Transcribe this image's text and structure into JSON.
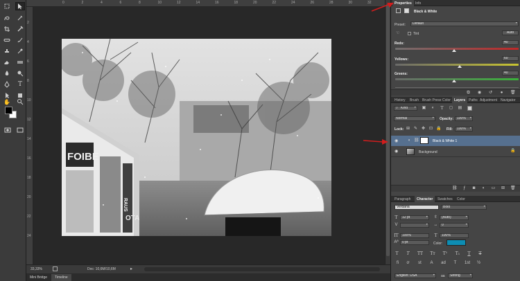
{
  "colors": {
    "accent_red": "#d11d1d",
    "layer_highlight": "#56708f",
    "text_color_chip": "#0d8db3"
  },
  "tools": [
    {
      "name": "move-tool-icon"
    },
    {
      "name": "artboard-tool-icon"
    },
    {
      "name": "marquee-tool-icon"
    },
    {
      "name": "lasso-tool-icon"
    },
    {
      "name": "quick-selection-tool-icon"
    },
    {
      "name": "magic-wand-tool-icon"
    },
    {
      "name": "crop-tool-icon"
    },
    {
      "name": "slice-tool-icon"
    },
    {
      "name": "eyedropper-tool-icon"
    },
    {
      "name": "ruler-tool-icon"
    },
    {
      "name": "healing-brush-tool-icon"
    },
    {
      "name": "patch-tool-icon"
    },
    {
      "name": "brush-tool-icon"
    },
    {
      "name": "pencil-tool-icon"
    },
    {
      "name": "clone-stamp-tool-icon"
    },
    {
      "name": "pattern-stamp-tool-icon"
    },
    {
      "name": "history-brush-tool-icon"
    },
    {
      "name": "eraser-tool-icon"
    },
    {
      "name": "gradient-tool-icon"
    },
    {
      "name": "blur-tool-icon"
    },
    {
      "name": "dodge-tool-icon"
    },
    {
      "name": "pen-tool-icon"
    },
    {
      "name": "type-tool-icon"
    },
    {
      "name": "path-selection-tool-icon"
    },
    {
      "name": "direct-selection-tool-icon"
    },
    {
      "name": "shape-tool-icon"
    },
    {
      "name": "hand-tool-icon"
    },
    {
      "name": "zoom-tool-icon"
    }
  ],
  "ruler": {
    "top": [
      "0",
      "2",
      "4",
      "6",
      "8",
      "10",
      "12",
      "14",
      "16",
      "18",
      "20",
      "22",
      "24",
      "26",
      "28",
      "30",
      "32",
      "34"
    ],
    "left": [
      "2",
      "4",
      "6",
      "8",
      "10",
      "12",
      "14",
      "16",
      "18",
      "20",
      "22",
      "24"
    ]
  },
  "status": {
    "zoom": "33,33%",
    "doc": "Doc: 10,6M/10,6M",
    "arrow": "▸"
  },
  "bottom_tabs": [
    "Mini Bridge",
    "Timeline"
  ],
  "properties": {
    "tabs": [
      "Properties",
      "Info"
    ],
    "title": "Black & White",
    "preset_label": "Preset:",
    "preset_value": "Default",
    "tint_label": "Tint",
    "auto_label": "Auto",
    "sliders": [
      {
        "label": "Reds:",
        "value": "40",
        "level": 40
      },
      {
        "label": "Yellows:",
        "value": "60",
        "level": 60
      },
      {
        "label": "Greens:",
        "value": "40",
        "level": 40
      }
    ]
  },
  "layers": {
    "tabs": [
      "History",
      "Brush",
      "Brush Prese",
      "Color",
      "Layers",
      "Paths",
      "Adjustment",
      "Navigator"
    ],
    "kind": "Kind",
    "blend_mode": "Normal",
    "opacity_label": "Opacity:",
    "opacity_value": "100%",
    "lock_label": "Lock:",
    "fill_label": "Fill:",
    "fill_value": "100%",
    "items": [
      {
        "name": "Black & White 1"
      },
      {
        "name": "Background"
      }
    ]
  },
  "character": {
    "tabs": [
      "Paragraph",
      "Character",
      "Swatches",
      "Color"
    ],
    "font": "Verdana",
    "style": "Bold",
    "size": "12 pt",
    "leading": "(Auto)",
    "tracking": "0",
    "vertical_scale": "100%",
    "horizontal_scale": "100%",
    "baseline": "0 pt",
    "color_label": "Color:",
    "type_styles": [
      "T",
      "T",
      "TT",
      "Tт",
      "T¹",
      "T₁",
      "T",
      "T"
    ],
    "open_type": [
      "fi",
      "ơ",
      "st",
      "A",
      "ad",
      "T",
      "1st",
      "½"
    ],
    "language": "English: USA",
    "aa_label": "aa",
    "antialias": "Strong"
  },
  "photo": {
    "signs": [
      "FOIBE",
      "RAUS",
      "OTA"
    ]
  }
}
